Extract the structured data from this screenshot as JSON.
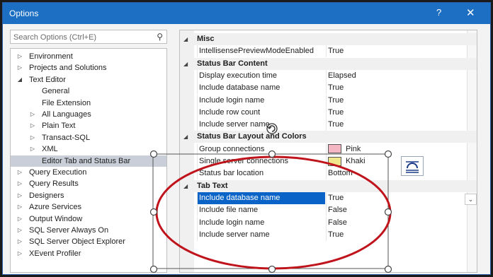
{
  "window": {
    "title": "Options",
    "help_label": "?",
    "close_label": "✕"
  },
  "search": {
    "placeholder": "Search Options (Ctrl+E)",
    "icon": "search-icon"
  },
  "tree": {
    "items": [
      {
        "label": "Environment",
        "level": 0,
        "arrow": "▷"
      },
      {
        "label": "Projects and Solutions",
        "level": 0,
        "arrow": "▷"
      },
      {
        "label": "Text Editor",
        "level": 0,
        "arrow": "◢"
      },
      {
        "label": "General",
        "level": 1,
        "arrow": ""
      },
      {
        "label": "File Extension",
        "level": 1,
        "arrow": ""
      },
      {
        "label": "All Languages",
        "level": 1,
        "arrow": "▷"
      },
      {
        "label": "Plain Text",
        "level": 1,
        "arrow": "▷"
      },
      {
        "label": "Transact-SQL",
        "level": 1,
        "arrow": "▷"
      },
      {
        "label": "XML",
        "level": 1,
        "arrow": "▷"
      },
      {
        "label": "Editor Tab and Status Bar",
        "level": 1,
        "arrow": "",
        "selected": true
      },
      {
        "label": "Query Execution",
        "level": 0,
        "arrow": "▷"
      },
      {
        "label": "Query Results",
        "level": 0,
        "arrow": "▷"
      },
      {
        "label": "Designers",
        "level": 0,
        "arrow": "▷"
      },
      {
        "label": "Azure Services",
        "level": 0,
        "arrow": "▷"
      },
      {
        "label": "Output Window",
        "level": 0,
        "arrow": "▷"
      },
      {
        "label": "SQL Server Always On",
        "level": 0,
        "arrow": "▷"
      },
      {
        "label": "SQL Server Object Explorer",
        "level": 0,
        "arrow": "▷"
      },
      {
        "label": "XEvent Profiler",
        "level": 0,
        "arrow": "▷"
      }
    ]
  },
  "properties": {
    "sections": [
      {
        "title": "Misc",
        "rows": [
          {
            "name": "IntellisensePreviewModeEnabled",
            "value": "True"
          }
        ]
      },
      {
        "title": "Status Bar Content",
        "rows": [
          {
            "name": "Display execution time",
            "value": "Elapsed"
          },
          {
            "name": "Include database name",
            "value": "True"
          },
          {
            "name": "Include login name",
            "value": "True"
          },
          {
            "name": "Include row count",
            "value": "True"
          },
          {
            "name": "Include server name",
            "value": "True"
          }
        ]
      },
      {
        "title": "Status Bar Layout and Colors",
        "rows": [
          {
            "name": "Group connections",
            "value": "Pink",
            "swatch": "#f4b6c2"
          },
          {
            "name": "Single server connections",
            "value": "Khaki",
            "swatch": "#f0e68c"
          },
          {
            "name": "Status bar location",
            "value": "Bottom"
          }
        ]
      },
      {
        "title": "Tab Text",
        "rows": [
          {
            "name": "Include database name",
            "value": "True",
            "selected": true
          },
          {
            "name": "Include file name",
            "value": "False"
          },
          {
            "name": "Include login name",
            "value": "False"
          },
          {
            "name": "Include server name",
            "value": "True"
          }
        ]
      }
    ]
  },
  "colors": {
    "titlebar": "#1d6fc4",
    "selection": "#0a64c8",
    "annotation": "#c0141c"
  },
  "icons": {
    "expanded": "◢",
    "collapsed": "▷",
    "dropdown": "chevron-down-icon",
    "rotate": "rotate-icon",
    "anchor": "text-wrap-icon"
  }
}
